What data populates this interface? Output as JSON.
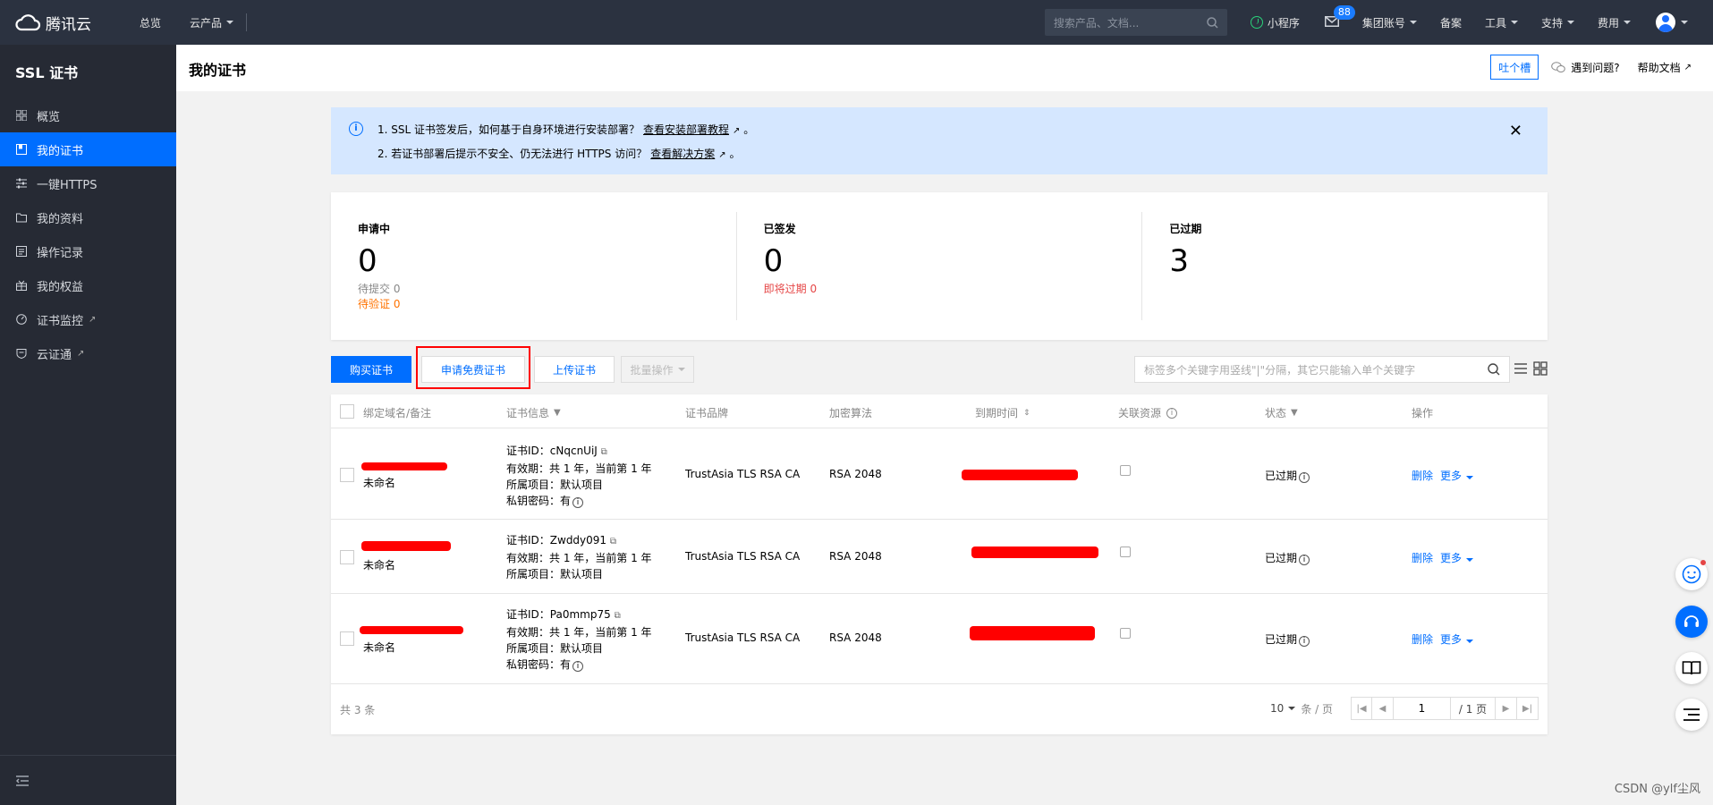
{
  "topbar": {
    "brand": "腾讯云",
    "nav": [
      "总览",
      "云产品"
    ],
    "search_placeholder": "搜索产品、文档...",
    "mini_program": "小程序",
    "mail_badge": "88",
    "links": [
      "集团账号",
      "备案",
      "工具",
      "支持",
      "费用"
    ]
  },
  "sidebar": {
    "title": "SSL 证书",
    "items": [
      {
        "label": "概览",
        "icon": "grid-icon"
      },
      {
        "label": "我的证书",
        "icon": "certificate-icon"
      },
      {
        "label": "一键HTTPS",
        "icon": "sliders-icon"
      },
      {
        "label": "我的资料",
        "icon": "folder-icon"
      },
      {
        "label": "操作记录",
        "icon": "log-icon"
      },
      {
        "label": "我的权益",
        "icon": "gift-icon"
      },
      {
        "label": "证书监控",
        "icon": "monitor-icon"
      },
      {
        "label": "云证通",
        "icon": "shield-icon"
      }
    ]
  },
  "header": {
    "title": "我的证书",
    "tucao": "吐个槽",
    "problem": "遇到问题?",
    "help": "帮助文档"
  },
  "notice": {
    "line1": "1. SSL 证书签发后，如何基于自身环境进行安装部署？",
    "link1": "查看安装部署教程",
    "line2": "2. 若证书部署后提示不安全、仍无法进行 HTTPS 访问？",
    "link2": "查看解决方案"
  },
  "stats": {
    "applying": {
      "title": "申请中",
      "value": "0",
      "sub1": "待提交 0",
      "sub2": "待验证 0"
    },
    "issued": {
      "title": "已签发",
      "value": "0",
      "sub1": "即将过期 0"
    },
    "expired": {
      "title": "已过期",
      "value": "3"
    }
  },
  "toolbar": {
    "buy": "购买证书",
    "free": "申请免费证书",
    "upload": "上传证书",
    "batch": "批量操作",
    "search_placeholder": "标签多个关键字用竖线\"|\"分隔，其它只能输入单个关键字"
  },
  "table": {
    "headers": {
      "domain": "绑定域名/备注",
      "info": "证书信息",
      "brand": "证书品牌",
      "algo": "加密算法",
      "expire": "到期时间",
      "resource": "关联资源",
      "status": "状态",
      "action": "操作"
    },
    "rows": [
      {
        "note": "未命名",
        "cert_id": "证书ID：cNqcnUiJ",
        "validity": "有效期：共 1 年，当前第 1 年",
        "project": "所属项目：默认项目",
        "key": "私钥密码：有",
        "brand": "TrustAsia TLS RSA CA",
        "algo": "RSA 2048",
        "status": "已过期",
        "delete": "删除",
        "more": "更多"
      },
      {
        "note": "未命名",
        "cert_id": "证书ID：Zwddy091",
        "validity": "有效期：共 1 年，当前第 1 年",
        "project": "所属项目：默认项目",
        "brand": "TrustAsia TLS RSA CA",
        "algo": "RSA 2048",
        "status": "已过期",
        "delete": "删除",
        "more": "更多"
      },
      {
        "note": "未命名",
        "cert_id": "证书ID：Pa0mmp75",
        "validity": "有效期：共 1 年，当前第 1 年",
        "project": "所属项目：默认项目",
        "key": "私钥密码：有",
        "brand": "TrustAsia TLS RSA CA",
        "algo": "RSA 2048",
        "status": "已过期",
        "delete": "删除",
        "more": "更多"
      }
    ],
    "total": "共 3 条",
    "page_size": "10",
    "per_page": "条 / 页",
    "page": "1",
    "pages": "/ 1 页"
  },
  "watermark": "CSDN @ylf尘风",
  "colors": {
    "primary": "#006eff",
    "topbar": "#2b3240",
    "sidebar": "#262a34",
    "warn": "#ff7200",
    "danger": "#e54545"
  }
}
